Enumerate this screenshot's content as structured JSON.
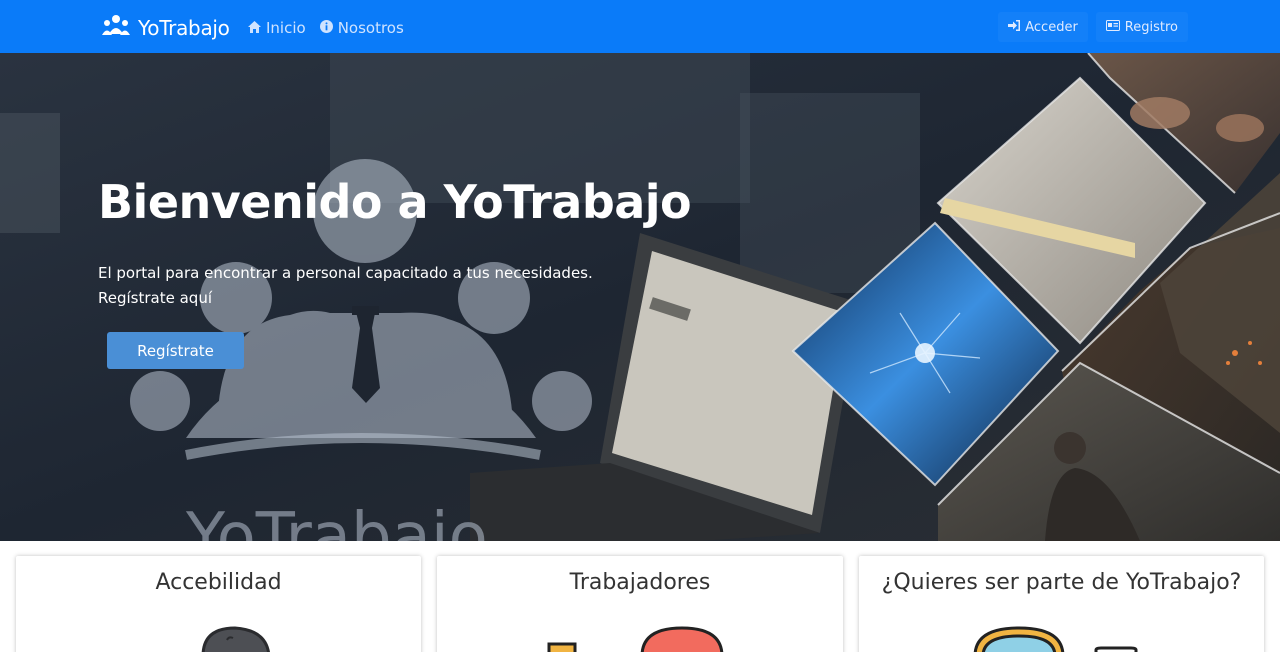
{
  "navbar": {
    "brand": "YoTrabajo",
    "links": [
      {
        "label": "Inicio",
        "icon": "home-icon"
      },
      {
        "label": "Nosotros",
        "icon": "info-icon"
      }
    ],
    "actions": [
      {
        "label": "Acceder",
        "icon": "sign-in-icon"
      },
      {
        "label": "Registro",
        "icon": "id-card-icon"
      }
    ]
  },
  "hero": {
    "title": "Bienvenido a YoTrabajo",
    "subtitle_line1": "El portal para encontrar a personal capacitado a tus necesidades.",
    "subtitle_line2": "Regístrate aquí",
    "button": "Regístrate",
    "watermark": "YoTrabajo"
  },
  "cards": [
    {
      "title": "Accebilidad",
      "icon": "hand-icon"
    },
    {
      "title": "Trabajadores",
      "icon": "workers-icon"
    },
    {
      "title": "¿Quieres ser parte de YoTrabajo?",
      "icon": "join-icon"
    }
  ],
  "colors": {
    "navbar": "#0a7bf9",
    "hero_button": "#4a8fd6"
  }
}
